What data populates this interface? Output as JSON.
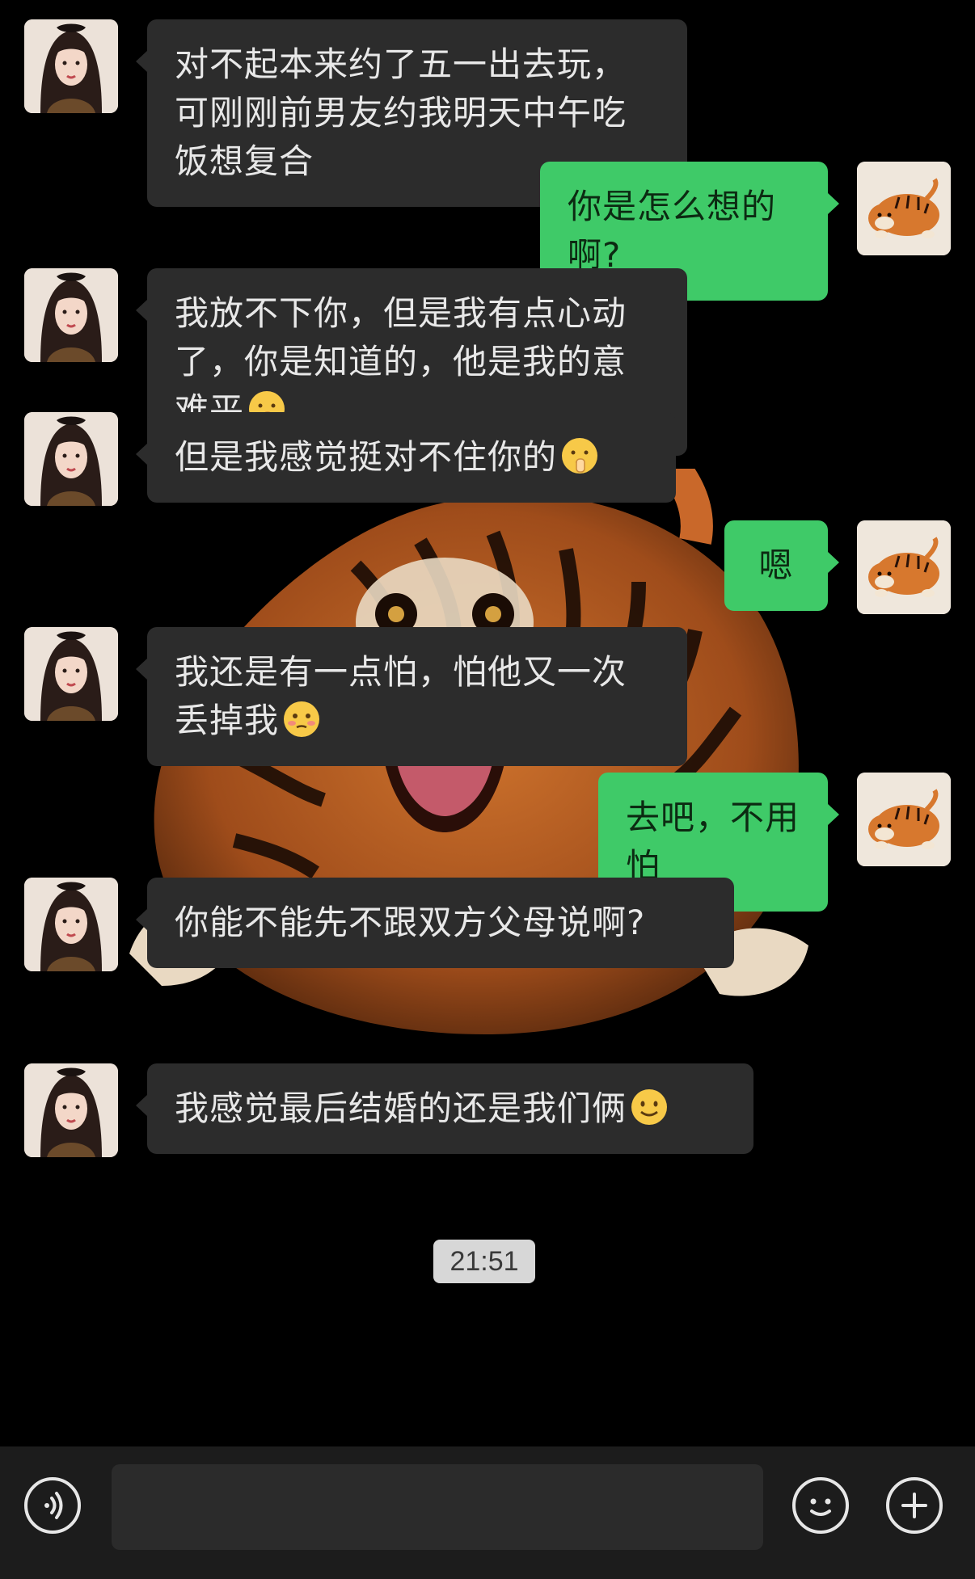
{
  "theme": {
    "background": "#000000",
    "incoming_bubble": "#2c2c2c",
    "outgoing_bubble": "#3fca68",
    "timestamp_bg": "#d7d7d7"
  },
  "messages": [
    {
      "sender": "them",
      "avatar": "girl-avatar",
      "text": "对不起本来约了五一出去玩，可刚刚前男友约我明天中午吃饭想复合",
      "emoji": ""
    },
    {
      "sender": "me",
      "avatar": "tiger-avatar",
      "text": "你是怎么想的啊?",
      "emoji": ""
    },
    {
      "sender": "them",
      "avatar": "girl-avatar",
      "text": "我放不下你，但是我有点心动了，你是知道的，他是我的意难平",
      "emoji": "shushing-face"
    },
    {
      "sender": "them",
      "avatar": "girl-avatar",
      "text": "但是我感觉挺对不住你的",
      "emoji": "shushing-face"
    },
    {
      "sender": "me",
      "avatar": "tiger-avatar",
      "text": "嗯",
      "emoji": ""
    },
    {
      "sender": "them",
      "avatar": "girl-avatar",
      "text": "我还是有一点怕，怕他又一次丢掉我",
      "emoji": "blushing-face"
    },
    {
      "sender": "me",
      "avatar": "tiger-avatar",
      "text": "去吧，不用怕",
      "emoji": ""
    },
    {
      "sender": "them",
      "avatar": "girl-avatar",
      "text": "你能不能先不跟双方父母说啊?",
      "emoji": ""
    },
    {
      "sender": "them",
      "avatar": "girl-avatar",
      "text": "我感觉最后结婚的还是我们俩",
      "emoji": "smiling-face"
    }
  ],
  "timestamp": "21:51",
  "input_bar": {
    "voice_icon": "voice-icon",
    "emoji_icon": "emoji-face-icon",
    "plus_icon": "plus-icon",
    "input_value": ""
  }
}
